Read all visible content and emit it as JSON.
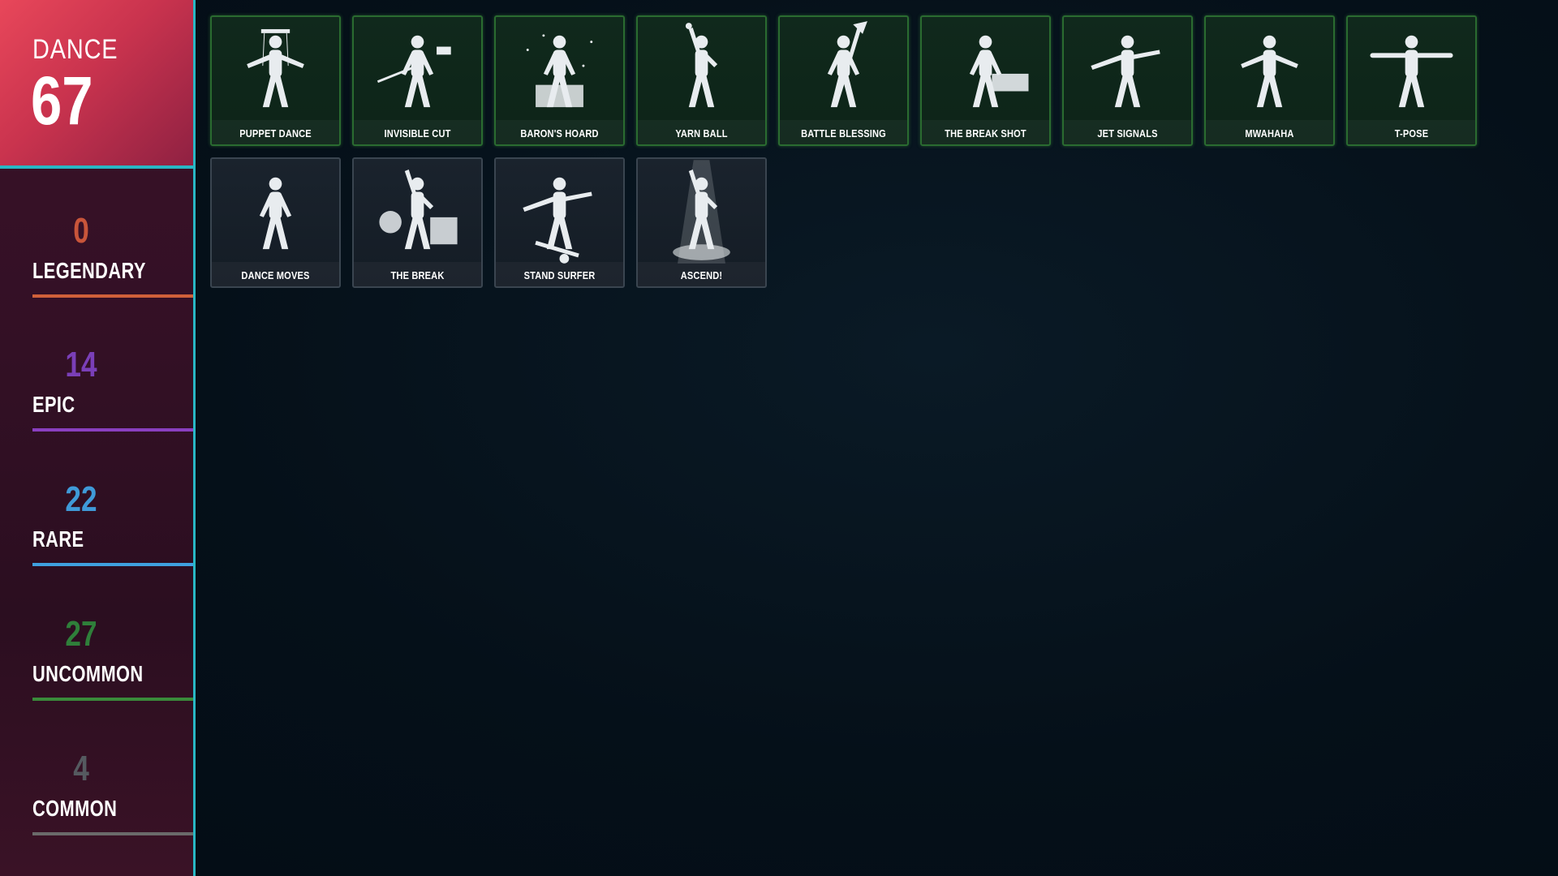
{
  "sidebar": {
    "header": {
      "title": "DANCE",
      "count": "67"
    },
    "rarities": [
      {
        "count": "0",
        "label": "LEGENDARY",
        "color": "#c8553a",
        "bar": "#d0603a"
      },
      {
        "count": "14",
        "label": "EPIC",
        "color": "#7a3fb8",
        "bar": "#8a3fc0"
      },
      {
        "count": "22",
        "label": "RARE",
        "color": "#3f9ad8",
        "bar": "#3fa0e0"
      },
      {
        "count": "27",
        "label": "UNCOMMON",
        "color": "#2f7f3a",
        "bar": "#3a8a3a"
      },
      {
        "count": "4",
        "label": "COMMON",
        "color": "#555a60",
        "bar": "#6a6a6a"
      }
    ]
  },
  "emotes": [
    {
      "name": "PUPPET DANCE",
      "rarity": "uncommon",
      "icon": "puppet-dance-icon"
    },
    {
      "name": "INVISIBLE CUT",
      "rarity": "uncommon",
      "icon": "invisible-cut-icon"
    },
    {
      "name": "BARON'S HOARD",
      "rarity": "uncommon",
      "icon": "barons-hoard-icon"
    },
    {
      "name": "YARN BALL",
      "rarity": "uncommon",
      "icon": "yarn-ball-icon"
    },
    {
      "name": "BATTLE BLESSING",
      "rarity": "uncommon",
      "icon": "battle-blessing-icon"
    },
    {
      "name": "THE BREAK SHOT",
      "rarity": "uncommon",
      "icon": "break-shot-icon"
    },
    {
      "name": "JET SIGNALS",
      "rarity": "uncommon",
      "icon": "jet-signals-icon"
    },
    {
      "name": "MWAHAHA",
      "rarity": "uncommon",
      "icon": "mwahaha-icon"
    },
    {
      "name": "T-POSE",
      "rarity": "uncommon",
      "icon": "t-pose-icon"
    },
    {
      "name": "DANCE MOVES",
      "rarity": "common",
      "icon": "dance-moves-icon"
    },
    {
      "name": "THE BREAK",
      "rarity": "common",
      "icon": "the-break-icon"
    },
    {
      "name": "STAND SURFER",
      "rarity": "common",
      "icon": "stand-surfer-icon"
    },
    {
      "name": "ASCEND!",
      "rarity": "common",
      "icon": "ascend-icon"
    }
  ]
}
